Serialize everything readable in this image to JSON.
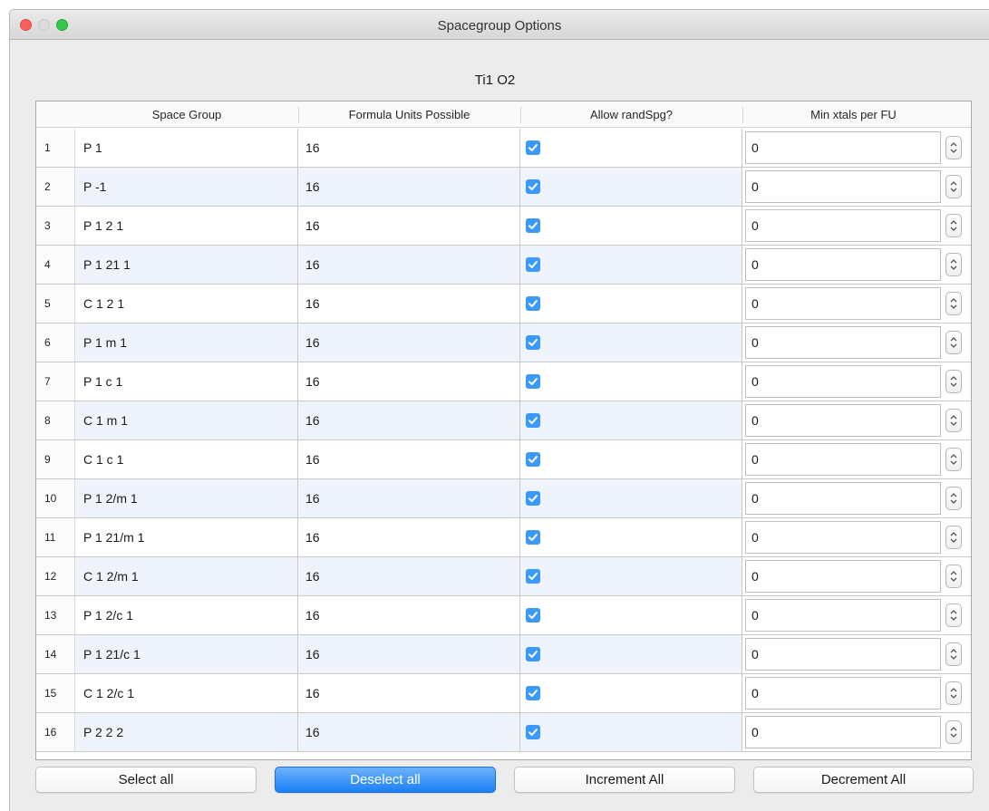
{
  "window": {
    "title": "Spacegroup Options"
  },
  "formula": "Ti1 O2",
  "colors": {
    "accent": "#3b99fc",
    "primary_button": "#1b7ff7",
    "alt_row": "#eef3fc"
  },
  "table": {
    "headers": [
      "Space Group",
      "Formula Units Possible",
      "Allow randSpg?",
      "Min xtals per FU"
    ],
    "rows": [
      {
        "index": "1",
        "space_group": "P 1",
        "fu": "16",
        "allow": true,
        "min": "0"
      },
      {
        "index": "2",
        "space_group": "P -1",
        "fu": "16",
        "allow": true,
        "min": "0"
      },
      {
        "index": "3",
        "space_group": "P 1 2 1",
        "fu": "16",
        "allow": true,
        "min": "0"
      },
      {
        "index": "4",
        "space_group": "P 1 21 1",
        "fu": "16",
        "allow": true,
        "min": "0"
      },
      {
        "index": "5",
        "space_group": "C 1 2 1",
        "fu": "16",
        "allow": true,
        "min": "0"
      },
      {
        "index": "6",
        "space_group": "P 1 m 1",
        "fu": "16",
        "allow": true,
        "min": "0"
      },
      {
        "index": "7",
        "space_group": "P 1 c 1",
        "fu": "16",
        "allow": true,
        "min": "0"
      },
      {
        "index": "8",
        "space_group": "C 1 m 1",
        "fu": "16",
        "allow": true,
        "min": "0"
      },
      {
        "index": "9",
        "space_group": "C 1 c 1",
        "fu": "16",
        "allow": true,
        "min": "0"
      },
      {
        "index": "10",
        "space_group": "P 1 2/m 1",
        "fu": "16",
        "allow": true,
        "min": "0"
      },
      {
        "index": "11",
        "space_group": "P 1 21/m 1",
        "fu": "16",
        "allow": true,
        "min": "0"
      },
      {
        "index": "12",
        "space_group": "C 1 2/m 1",
        "fu": "16",
        "allow": true,
        "min": "0"
      },
      {
        "index": "13",
        "space_group": "P 1 2/c 1",
        "fu": "16",
        "allow": true,
        "min": "0"
      },
      {
        "index": "14",
        "space_group": "P 1 21/c 1",
        "fu": "16",
        "allow": true,
        "min": "0"
      },
      {
        "index": "15",
        "space_group": "C 1 2/c 1",
        "fu": "16",
        "allow": true,
        "min": "0"
      },
      {
        "index": "16",
        "space_group": "P 2 2 2",
        "fu": "16",
        "allow": true,
        "min": "0"
      }
    ]
  },
  "buttons": {
    "select_all": "Select all",
    "deselect_all": "Deselect all",
    "increment_all": "Increment All",
    "decrement_all": "Decrement All"
  },
  "icons": {
    "close": "close-icon",
    "minimize": "minimize-icon",
    "maximize": "maximize-icon",
    "check": "checkmark-icon",
    "stepper": "stepper-arrows-icon"
  }
}
